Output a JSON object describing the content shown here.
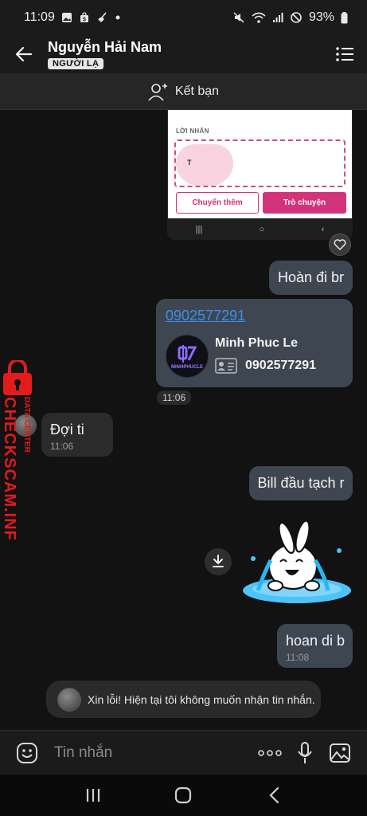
{
  "status_bar": {
    "time": "11:09",
    "battery": "93%",
    "left_icons": [
      "image-icon",
      "shopping-bag-icon",
      "broom-icon",
      "dot-icon"
    ],
    "right_icons": [
      "mute-icon",
      "wifi-icon",
      "signal-icon",
      "blocked-icon",
      "battery-icon"
    ]
  },
  "header": {
    "contact_name": "Nguyễn Hải Nam",
    "badge": "NGƯỜI LẠ"
  },
  "friend_bar": {
    "label": "Kết bạn"
  },
  "screenshot_preview": {
    "label": "LỜI NHẮN",
    "typed": "T",
    "button_outline": "Chuyển thêm",
    "button_filled": "Trò chuyện"
  },
  "messages": {
    "m1": {
      "text": "Hoàn đi br"
    },
    "card": {
      "phone_link": "0902577291",
      "name": "Minh Phuc Le",
      "number": "0902577291",
      "logo_text": "MINHPHUCLE",
      "time": "11:06"
    },
    "m2": {
      "text": "Đợi ti",
      "time": "11:06"
    },
    "m3": {
      "text": "Bill đầu tạch r"
    },
    "m4": {
      "text": "hoan di b",
      "time": "11:08"
    }
  },
  "notice": {
    "text": "Xin lỗi! Hiện tại tôi không muốn nhận tin nhắn."
  },
  "watermark": {
    "line1": "DATA CENTER",
    "line2": "CHECKSCAM.INFO"
  },
  "composer": {
    "placeholder": "Tin nhắn"
  },
  "colors": {
    "accent_pink": "#d3337b",
    "link_blue": "#3d8fe6",
    "outgoing_bubble": "#3e4652",
    "incoming_bubble": "#2b2b2b",
    "watermark_red": "#e21b1b"
  }
}
